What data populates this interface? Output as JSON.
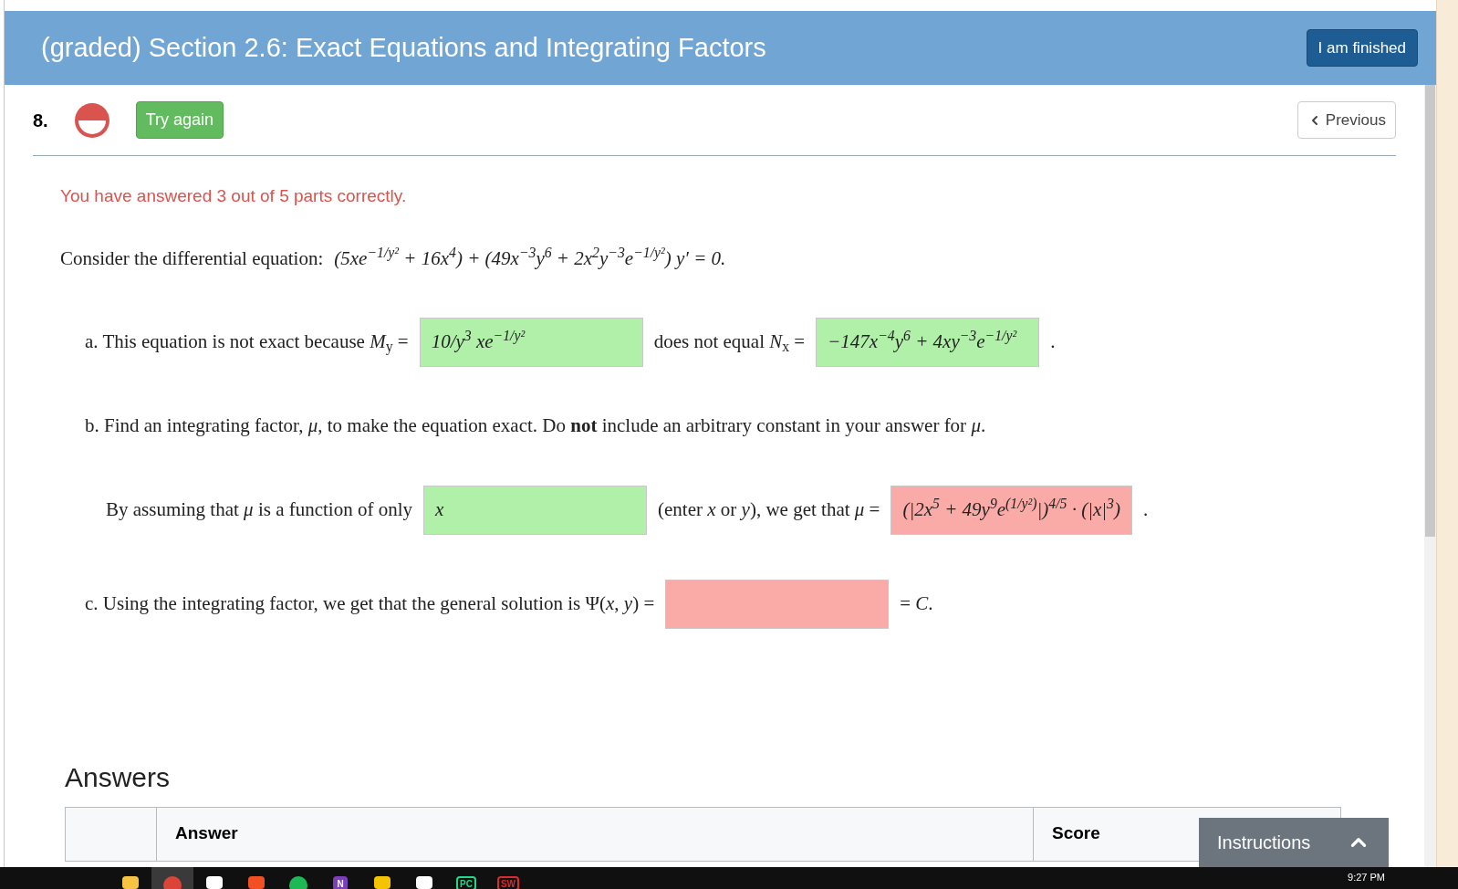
{
  "header": {
    "title": "(graded) Section 2.6: Exact Equations and Integrating Factors",
    "finish_button": "I am finished"
  },
  "question": {
    "number": "8.",
    "progress_icon": {
      "kind": "partial"
    },
    "try_again": "Try again",
    "previous": "Previous"
  },
  "feedback": "You have answered 3 out of 5 parts correctly.",
  "rows": [
    {
      "kind": "plain",
      "segments": [
        {
          "kind": "text",
          "text": "Consider the differential equation:"
        },
        {
          "kind": "math",
          "text": "(5xe$^{−1/y²}$ + 16x$^{4}$) + (49x$^{−3}$y$^{6}$ + 2x$^{2}$y$^{−3}$e$^{−1/y²}$) y′ = 0."
        }
      ]
    },
    {
      "kind": "part",
      "segments": [
        {
          "kind": "text",
          "text": "a. This equation is not exact because *M*$_{y}$ ="
        },
        {
          "kind": "answer",
          "value": "10/y$^{3}$ xe$^{−1/y²}$",
          "correct": true
        },
        {
          "kind": "text",
          "text": "does not equal *N*$_{x}$ ="
        },
        {
          "kind": "answer",
          "value": "−147x$^{−4}$y$^{6}$ + 4xy$^{−3}$e$^{−1/y²}$",
          "correct": true
        },
        {
          "kind": "text",
          "text": "."
        }
      ]
    },
    {
      "kind": "part",
      "segments": [
        {
          "kind": "text",
          "text": "b. Find an integrating factor, *μ*, to make the equation exact. Do **not** include an arbitrary constant in your answer for *μ*."
        }
      ]
    },
    {
      "kind": "sub",
      "segments": [
        {
          "kind": "text",
          "text": "By assuming that *μ* is a function of only"
        },
        {
          "kind": "answer",
          "value": "*x*",
          "correct": true
        },
        {
          "kind": "text",
          "text": "(enter *x* or *y*), we get that *μ* ="
        },
        {
          "kind": "answer",
          "value": "(|2x$^{5}$ + 49y$^{9}$e$^{(1/y²)}$|)$^{4/5}$ · (|x|$^{3}$)",
          "correct": false
        },
        {
          "kind": "text",
          "text": "."
        }
      ]
    },
    {
      "kind": "part",
      "segments": [
        {
          "kind": "text",
          "text": "c. Using the integrating factor, we get that the general solution is Ψ(*x*, *y*) ="
        },
        {
          "kind": "answer",
          "correct": false
        },
        {
          "kind": "text",
          "text": "= *C*."
        }
      ]
    }
  ],
  "answers": {
    "title": "Answers",
    "columns": [
      "Answer",
      "Score"
    ]
  },
  "instructions": {
    "label": "Instructions",
    "expanded": false
  },
  "taskbar": {
    "apps": [
      {
        "kind": "folder"
      },
      {
        "kind": "browser"
      },
      {
        "kind": "mail"
      },
      {
        "kind": "store"
      },
      {
        "kind": "music"
      },
      {
        "kind": "notes",
        "label": "N"
      },
      {
        "kind": "check"
      },
      {
        "kind": "calendar"
      },
      {
        "kind": "ide",
        "label": "PC"
      },
      {
        "kind": "cad",
        "label": "SW"
      }
    ],
    "time": "9:27 PM"
  }
}
